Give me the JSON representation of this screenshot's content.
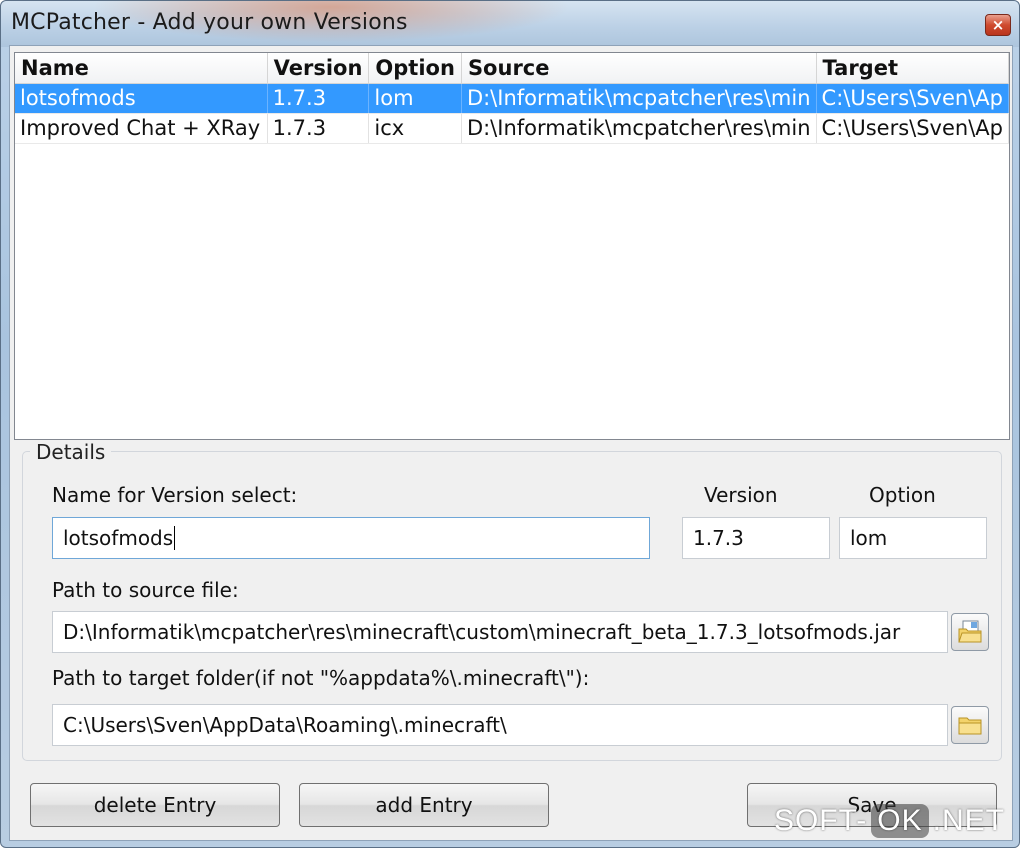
{
  "window": {
    "title": "MCPatcher - Add your own Versions",
    "close_glyph": "×"
  },
  "table": {
    "columns": [
      "Name",
      "Version",
      "Option",
      "Source",
      "Target"
    ],
    "rows": [
      {
        "name": "lotsofmods",
        "version": "1.7.3",
        "option": "lom",
        "source": "D:\\Informatik\\mcpatcher\\res\\min",
        "target": "C:\\Users\\Sven\\Ap",
        "selected": true
      },
      {
        "name": "Improved Chat + XRay",
        "version": "1.7.3",
        "option": "icx",
        "source": "D:\\Informatik\\mcpatcher\\res\\min",
        "target": "C:\\Users\\Sven\\Ap",
        "selected": false
      }
    ]
  },
  "details": {
    "legend": "Details",
    "name_label": "Name for Version select:",
    "name_value": "lotsofmods",
    "version_label": "Version",
    "version_value": "1.7.3",
    "option_label": "Option",
    "option_value": "lom",
    "source_label": "Path to source file:",
    "source_value": "D:\\Informatik\\mcpatcher\\res\\minecraft\\custom\\minecraft_beta_1.7.3_lotsofmods.jar",
    "target_label": "Path to target folder(if not \"%appdata%\\.minecraft\\\"):",
    "target_value": "C:\\Users\\Sven\\AppData\\Roaming\\.minecraft\\"
  },
  "buttons": {
    "delete": "delete Entry",
    "add": "add Entry",
    "save": "Save"
  },
  "watermark": {
    "left": "SOFT-",
    "mid": "OK",
    "right": ".NET"
  },
  "icons": {
    "source_browse": "open-file-icon",
    "target_browse": "folder-icon"
  },
  "colors": {
    "selection": "#3399ff",
    "window_frame": "#a9c4df"
  }
}
